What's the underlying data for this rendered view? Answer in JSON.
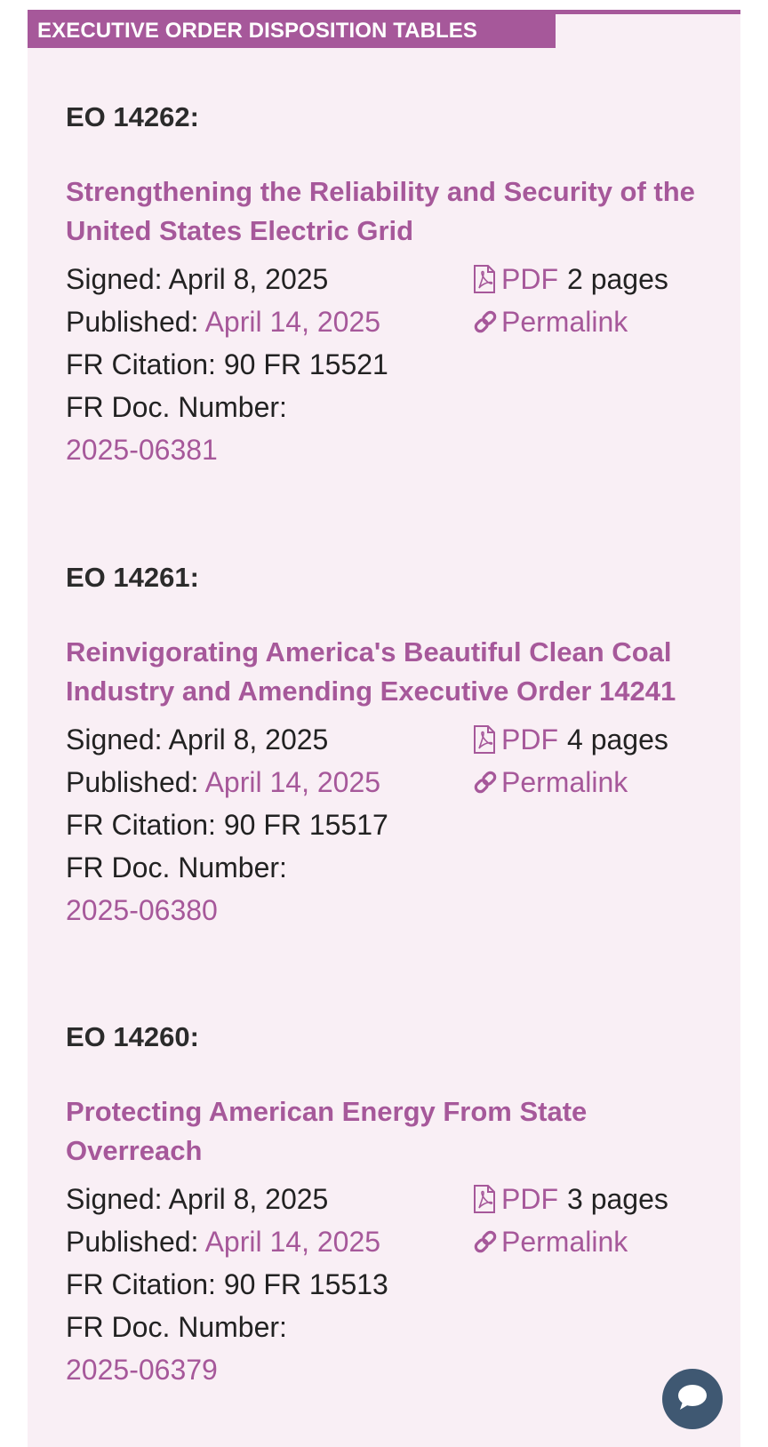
{
  "header": {
    "title": "EXECUTIVE ORDER DISPOSITION TABLES"
  },
  "orders": [
    {
      "eo_label": "EO 14262:",
      "title": "Strengthening the Reliability and Security of the United States Electric Grid",
      "signed_label": "Signed:",
      "signed": "April 8, 2025",
      "published_label": "Published:",
      "published": "April 14, 2025",
      "citation_label": "FR Citation:",
      "citation": "90 FR 15521",
      "doc_label": "FR Doc. Number:",
      "doc_number": "2025-06381",
      "pdf_label": "PDF",
      "pages": "2 pages",
      "permalink_label": "Permalink"
    },
    {
      "eo_label": "EO 14261:",
      "title": "Reinvigorating America's Beautiful Clean Coal Industry and Amending Executive Order 14241",
      "signed_label": "Signed:",
      "signed": "April 8, 2025",
      "published_label": "Published:",
      "published": "April 14, 2025",
      "citation_label": "FR Citation:",
      "citation": "90 FR 15517",
      "doc_label": "FR Doc. Number:",
      "doc_number": "2025-06380",
      "pdf_label": "PDF",
      "pages": "4 pages",
      "permalink_label": "Permalink"
    },
    {
      "eo_label": "EO 14260:",
      "title": "Protecting American Energy From State Overreach",
      "signed_label": "Signed:",
      "signed": "April 8, 2025",
      "published_label": "Published:",
      "published": "April 14, 2025",
      "citation_label": "FR Citation:",
      "citation": "90 FR 15513",
      "doc_label": "FR Doc. Number:",
      "doc_number": "2025-06379",
      "pdf_label": "PDF",
      "pages": "3 pages",
      "permalink_label": "Permalink"
    }
  ],
  "chat": {
    "icon": "chat-bubble-icon"
  },
  "colors": {
    "accent": "#a6589a",
    "panel_bg": "#f9eff5",
    "text": "#222222",
    "chat_button": "#3f5872"
  }
}
